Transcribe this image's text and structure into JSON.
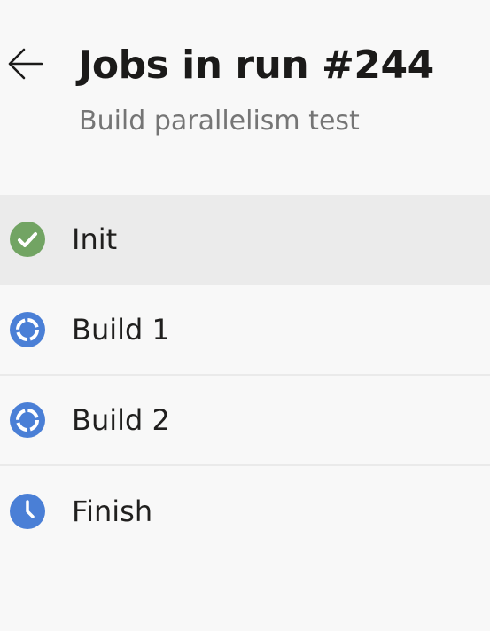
{
  "header": {
    "back_icon": "arrow-left-icon",
    "title": "Jobs in run #244",
    "subtitle": "Build parallelism test"
  },
  "jobs": [
    {
      "name": "Init",
      "status": "succeeded",
      "icon": "check-circle-icon",
      "selected": true
    },
    {
      "name": "Build 1",
      "status": "running",
      "icon": "in-progress-icon",
      "selected": false
    },
    {
      "name": "Build 2",
      "status": "running",
      "icon": "in-progress-icon",
      "selected": false
    },
    {
      "name": "Finish",
      "status": "queued",
      "icon": "clock-icon",
      "selected": false
    }
  ],
  "colors": {
    "succeeded": "#72a463",
    "running": "#4a7fd6",
    "queued": "#4a7fd6",
    "selected_row": "#ebebeb",
    "background": "#f8f8f8"
  }
}
